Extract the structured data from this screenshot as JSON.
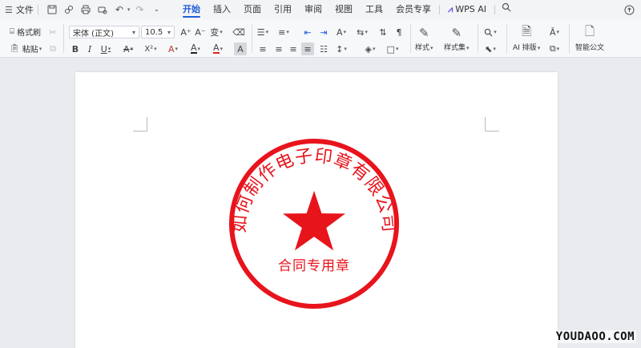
{
  "menu": {
    "file_label": "文件",
    "tabs": [
      {
        "label": "开始",
        "active": true
      },
      {
        "label": "插入"
      },
      {
        "label": "页面"
      },
      {
        "label": "引用"
      },
      {
        "label": "审阅"
      },
      {
        "label": "视图"
      },
      {
        "label": "工具"
      },
      {
        "label": "会员专享"
      },
      {
        "label": "WPS AI"
      }
    ]
  },
  "ribbon": {
    "format_painter": "格式刷",
    "paste": "粘贴",
    "font_name": "宋体 (正文)",
    "font_size": "10.5",
    "styles": "样式",
    "style_set": "样式集",
    "ai_layout": "AI 排版",
    "smart_doc": "智能公文",
    "bold": "B",
    "italic": "I",
    "underline": "U",
    "strike": "A",
    "superscript": "X²",
    "grow_font": "A⁺",
    "shrink_font": "A⁻",
    "phonetic": "变",
    "text_effect": "A",
    "highlight": "A",
    "font_color": "A",
    "char_shading": "A"
  },
  "seal": {
    "company_name": "如何制作电子印章有限公司",
    "seal_type": "合同专用章",
    "color": "#e8141c"
  },
  "watermark": "YOUDAOO.COM",
  "colors": {
    "accent": "#1e5ed8",
    "seal_red": "#e8141c",
    "font_color_bar": "#e02020"
  }
}
